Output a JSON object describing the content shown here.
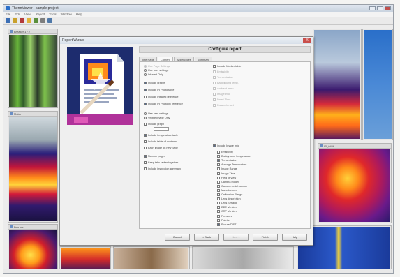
{
  "app": {
    "title": "ThermViewer - sample project",
    "menu": [
      "File",
      "Edit",
      "View",
      "Report",
      "Tools",
      "Window",
      "Help"
    ]
  },
  "toolbar": {
    "icons": [
      "open-icon",
      "save-icon",
      "print-icon",
      "folder-icon",
      "image-icon",
      "settings-icon",
      "report-icon"
    ]
  },
  "panes": [
    {
      "title": "Breaker 1 / 2"
    },
    {
      "title": "Motor"
    },
    {
      "title": "Bus bar"
    },
    {
      "title": "IR_0456"
    }
  ],
  "dialog": {
    "title": "Report Wizard",
    "heading": "Configure report",
    "close": "X",
    "tabs": [
      "Title Page",
      "Content",
      "Appendices",
      "Summary"
    ],
    "active_tab": "Content",
    "left_options": [
      {
        "label": "Use Page Settings",
        "state": "on",
        "kind": "radio",
        "dim": true
      },
      {
        "label": "Use user settings",
        "state": "off",
        "kind": "radio",
        "dim": false
      },
      {
        "label": "Infrared Only",
        "state": "off",
        "kind": "radio",
        "dim": false
      },
      {
        "label": "Include graphs",
        "state": "on",
        "kind": "check",
        "dim": false
      },
      {
        "label": "Include IR Photo table",
        "state": "on",
        "kind": "check",
        "dim": false
      },
      {
        "label": "Include Infrared reference",
        "state": "off",
        "kind": "check",
        "dim": false
      },
      {
        "label": "Include IR Photo/IR reference",
        "state": "on",
        "kind": "check",
        "dim": false
      },
      {
        "label": "Use user settings",
        "state": "off",
        "kind": "radio",
        "dim": false
      },
      {
        "label": "Visible Image Only",
        "state": "off",
        "kind": "radio",
        "dim": false
      },
      {
        "label": "Include graph",
        "state": "off",
        "kind": "check",
        "dim": false
      },
      {
        "label": "Include temperature table",
        "state": "on",
        "kind": "check",
        "dim": false
      },
      {
        "label": "Include table of contents",
        "state": "off",
        "kind": "check",
        "dim": false
      },
      {
        "label": "Each image on new page",
        "state": "off",
        "kind": "check",
        "dim": false
      },
      {
        "label": "Number pages",
        "state": "on",
        "kind": "check",
        "dim": false
      },
      {
        "label": "Keep tabs tables together",
        "state": "off",
        "kind": "check",
        "dim": false
      },
      {
        "label": "Include inspection summary",
        "state": "off",
        "kind": "check",
        "dim": false
      }
    ],
    "right_top_options": [
      {
        "label": "Include Marker table",
        "state": "off",
        "kind": "check",
        "dim": false
      },
      {
        "label": "Emissivity",
        "state": "off",
        "kind": "check",
        "dim": true
      },
      {
        "label": "Transmission",
        "state": "off",
        "kind": "check",
        "dim": true
      },
      {
        "label": "Background temp.",
        "state": "off",
        "kind": "check",
        "dim": true
      },
      {
        "label": "Ambient temp.",
        "state": "off",
        "kind": "check",
        "dim": true
      },
      {
        "label": "Image Info",
        "state": "off",
        "kind": "check",
        "dim": true
      },
      {
        "label": "Date / Time",
        "state": "off",
        "kind": "check",
        "dim": true
      },
      {
        "label": "Parameter set",
        "state": "off",
        "kind": "check",
        "dim": true
      }
    ],
    "right_options_header": {
      "label": "Include Image Info",
      "state": "on"
    },
    "right_options": [
      {
        "label": "Emissivity",
        "state": "off"
      },
      {
        "label": "Background temperature",
        "state": "off"
      },
      {
        "label": "Transmission",
        "state": "on"
      },
      {
        "label": "Average Temperature",
        "state": "off"
      },
      {
        "label": "Image Range",
        "state": "off"
      },
      {
        "label": "Image Time",
        "state": "off"
      },
      {
        "label": "Field of view",
        "state": "off"
      },
      {
        "label": "Camera model",
        "state": "off"
      },
      {
        "label": "Camera serial number",
        "state": "off"
      },
      {
        "label": "Manufacturer",
        "state": "off"
      },
      {
        "label": "Calibration Range",
        "state": "off"
      },
      {
        "label": "Lens description",
        "state": "off"
      },
      {
        "label": "Lens Serial #",
        "state": "off"
      },
      {
        "label": "DDE Version",
        "state": "off"
      },
      {
        "label": "CRP Version",
        "state": "off"
      },
      {
        "label": "Firmware",
        "state": "off"
      },
      {
        "label": "Palette",
        "state": "off"
      },
      {
        "label": "Picture DIST",
        "state": "on"
      }
    ],
    "buttons": [
      {
        "label": "Cancel",
        "disabled": false
      },
      {
        "label": "< Back",
        "disabled": false
      },
      {
        "label": "Next >",
        "disabled": true
      },
      {
        "label": "Finish",
        "disabled": false
      },
      {
        "label": "Help",
        "disabled": false
      }
    ]
  },
  "colors": {
    "accent": "#2a6fc9",
    "dialog_bg": "#efefef",
    "thermal_hot": "#ffdd33",
    "thermal_cold": "#2a0a6e"
  }
}
